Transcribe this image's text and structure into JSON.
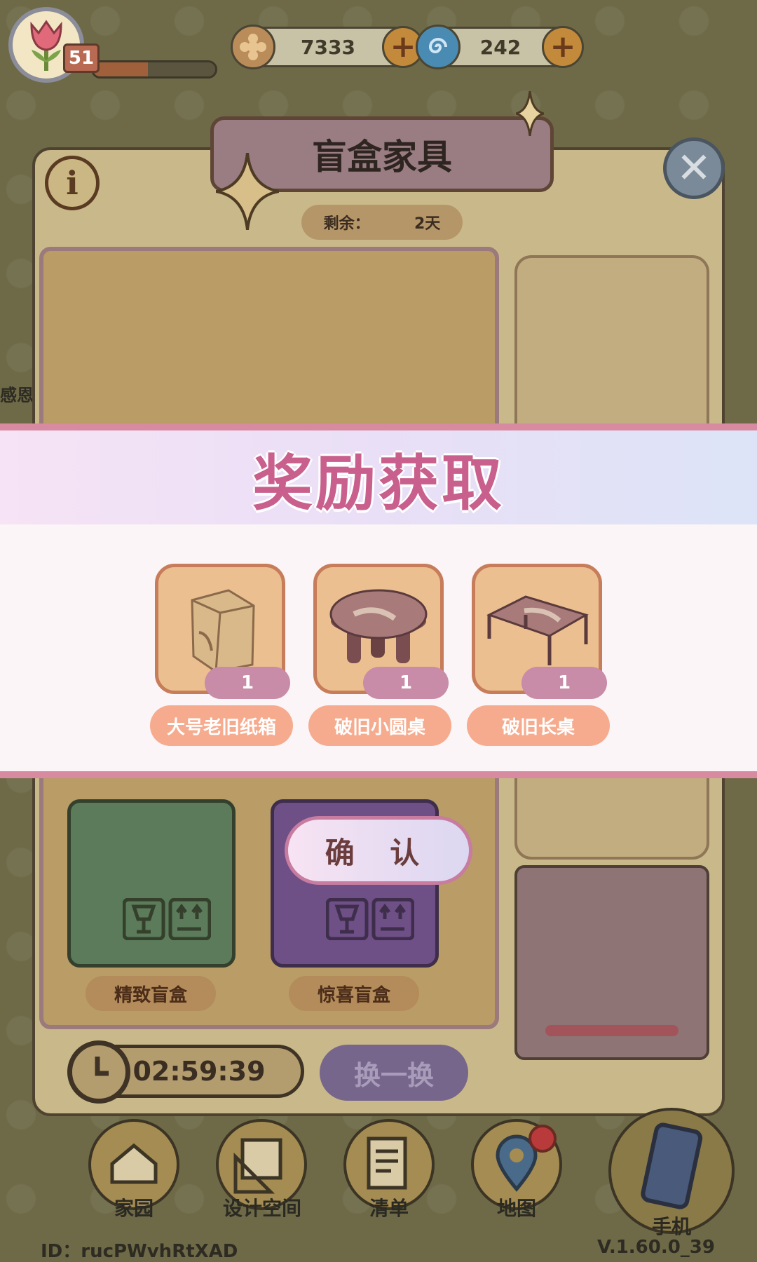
{
  "hud": {
    "level": "51",
    "xp_progress": 0.45,
    "coins": "7333",
    "gems": "242",
    "coin_icon": "flower-coin-icon",
    "gem_icon": "spiral-gem-icon"
  },
  "dialog": {
    "title": "盲盒家具",
    "remaining_label": "剩余：",
    "remaining_value": "2天",
    "boxes": [
      {
        "label": "精致盲盒",
        "color": "#5b7b5a"
      },
      {
        "label": "惊喜盲盒",
        "color": "#6e4f86"
      }
    ],
    "timer": "02:59:39",
    "swap_label": "换一换"
  },
  "reward": {
    "title": "奖励获取",
    "items": [
      {
        "name": "大号老旧纸箱",
        "count": "1",
        "icon": "cardboard-box-icon"
      },
      {
        "name": "破旧小圆桌",
        "count": "1",
        "icon": "round-table-icon"
      },
      {
        "name": "破旧长桌",
        "count": "1",
        "icon": "long-table-icon"
      }
    ],
    "confirm_label": "确 认"
  },
  "side_label": "感恩",
  "nav": [
    {
      "label": "家园",
      "icon": "home-icon"
    },
    {
      "label": "设计空间",
      "icon": "design-icon"
    },
    {
      "label": "清单",
      "icon": "list-icon"
    },
    {
      "label": "地图",
      "icon": "map-pin-icon"
    },
    {
      "label": "手机",
      "icon": "phone-icon"
    }
  ],
  "footer": {
    "id": "ID：rucPWvhRtXAD",
    "version": "V.1.60.0_39"
  },
  "colors": {
    "reward_title": "#c95f8c",
    "item_name_bg": "#f6ab8e",
    "count_badge_bg": "#c88ba8"
  }
}
